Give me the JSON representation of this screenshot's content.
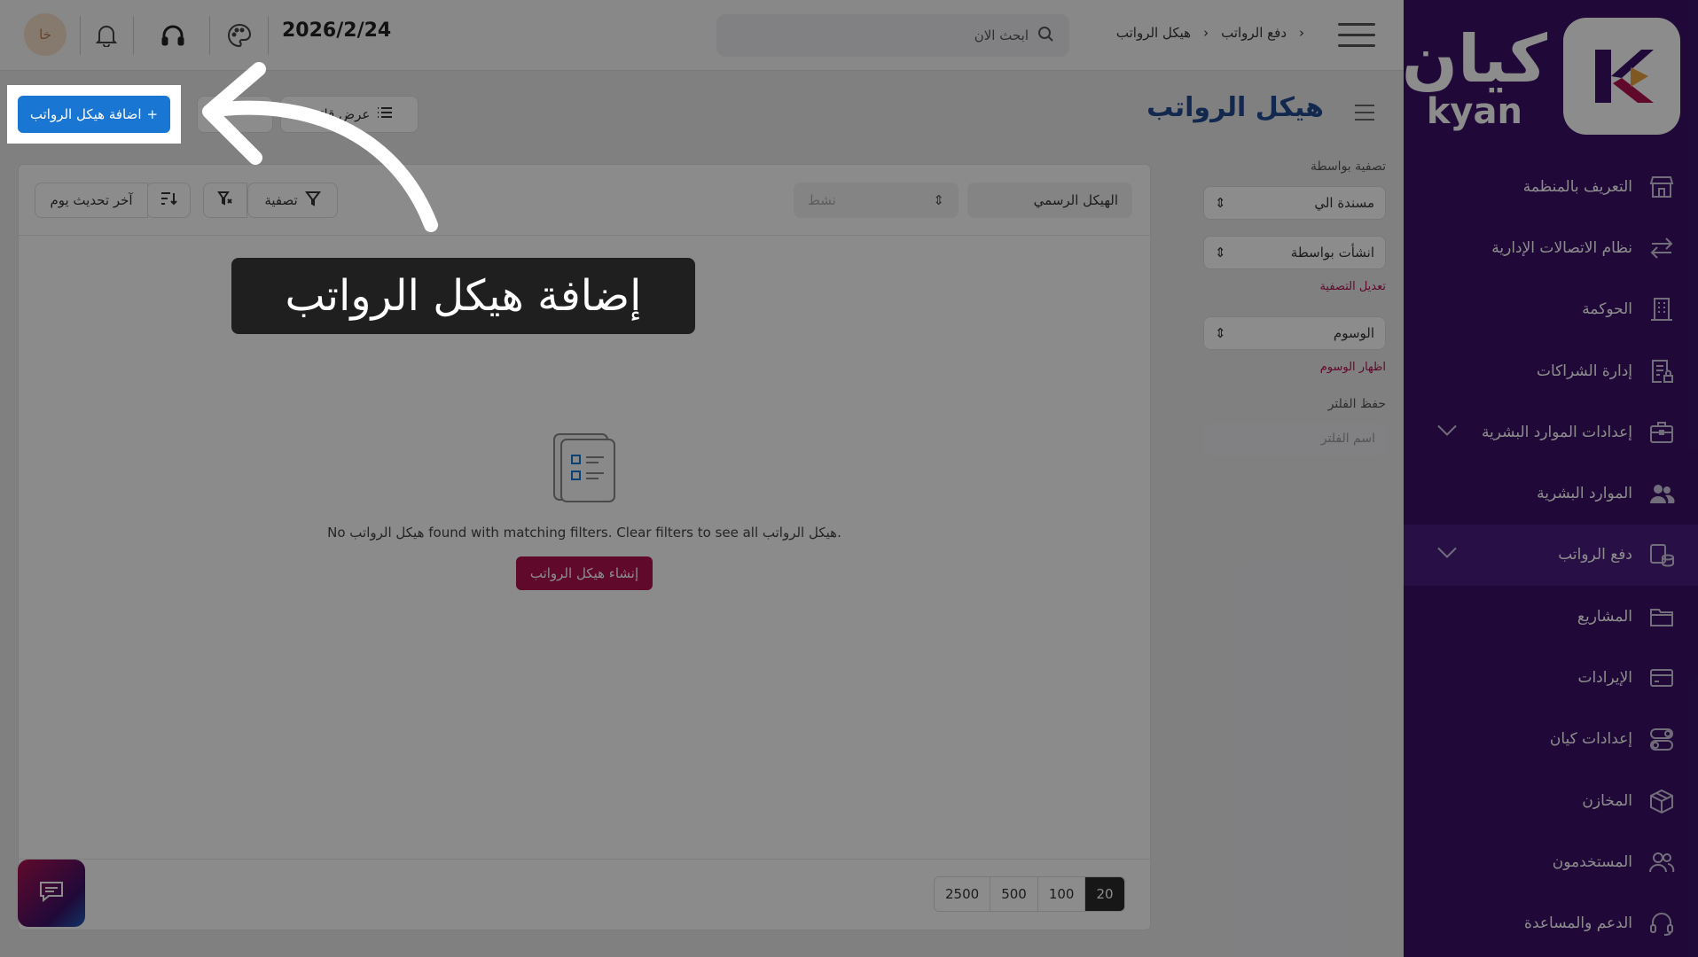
{
  "brand": {
    "name_ar": "كيان",
    "name_en": "kyan"
  },
  "topbar": {
    "breadcrumb": [
      "دفع الرواتب",
      "هيكل الرواتب"
    ],
    "search_placeholder": "ابحث الان",
    "date": "2026/2/24",
    "avatar_initials": "خا"
  },
  "sidebar": {
    "items": [
      {
        "label": "التعريف بالمنظمة",
        "icon": "store-icon"
      },
      {
        "label": "نظام الاتصالات الإدارية",
        "icon": "exchange-icon"
      },
      {
        "label": "الحوكمة",
        "icon": "building-icon"
      },
      {
        "label": "إدارة الشراكات",
        "icon": "document-lock-icon"
      },
      {
        "label": "إعدادات الموارد البشرية",
        "icon": "briefcase-icon"
      },
      {
        "label": "الموارد البشرية",
        "icon": "users-icon"
      },
      {
        "label": "دفع الرواتب",
        "icon": "payroll-icon"
      },
      {
        "label": "المشاريع",
        "icon": "folder-icon"
      },
      {
        "label": "الإيرادات",
        "icon": "card-icon"
      },
      {
        "label": "إعدادات كيان",
        "icon": "toggle-icon"
      },
      {
        "label": "المخازن",
        "icon": "box-icon"
      },
      {
        "label": "المستخدمون",
        "icon": "users-outline-icon"
      },
      {
        "label": "الدعم والمساعدة",
        "icon": "headset-icon"
      }
    ]
  },
  "page": {
    "title": "هيكل الرواتب",
    "add_button": "اضافة هيكل الرواتب",
    "list_view": "عرض قائمة"
  },
  "filters": {
    "title": "تصفية بواسطة",
    "assigned_to": "مسندة الي",
    "created_by": "انشأت بواسطة",
    "edit_filter": "تعديل التصفية",
    "tags": "الوسوم",
    "show_tags": "اظهار الوسوم",
    "save_filter": "حفظ الفلتر",
    "filter_name_placeholder": "اسم الفلتر"
  },
  "toolbar": {
    "structure_filter": "الهيكل الرسمي",
    "status_placeholder": "نشط",
    "filter": "تصفية",
    "last_update": "آخر تحديث يوم"
  },
  "empty": {
    "message": "No هيكل الرواتب found with matching filters. Clear filters to see all هيكل الرواتب.",
    "create_button": "إنشاء هيكل الرواتب"
  },
  "pager": [
    "20",
    "100",
    "500",
    "2500"
  ],
  "tooltip": {
    "text": "إضافة هيكل الرواتب"
  },
  "colors": {
    "sidebar": "#3b1269",
    "accent": "#b0124f",
    "primary": "#1976d2",
    "title": "#234a8e"
  }
}
